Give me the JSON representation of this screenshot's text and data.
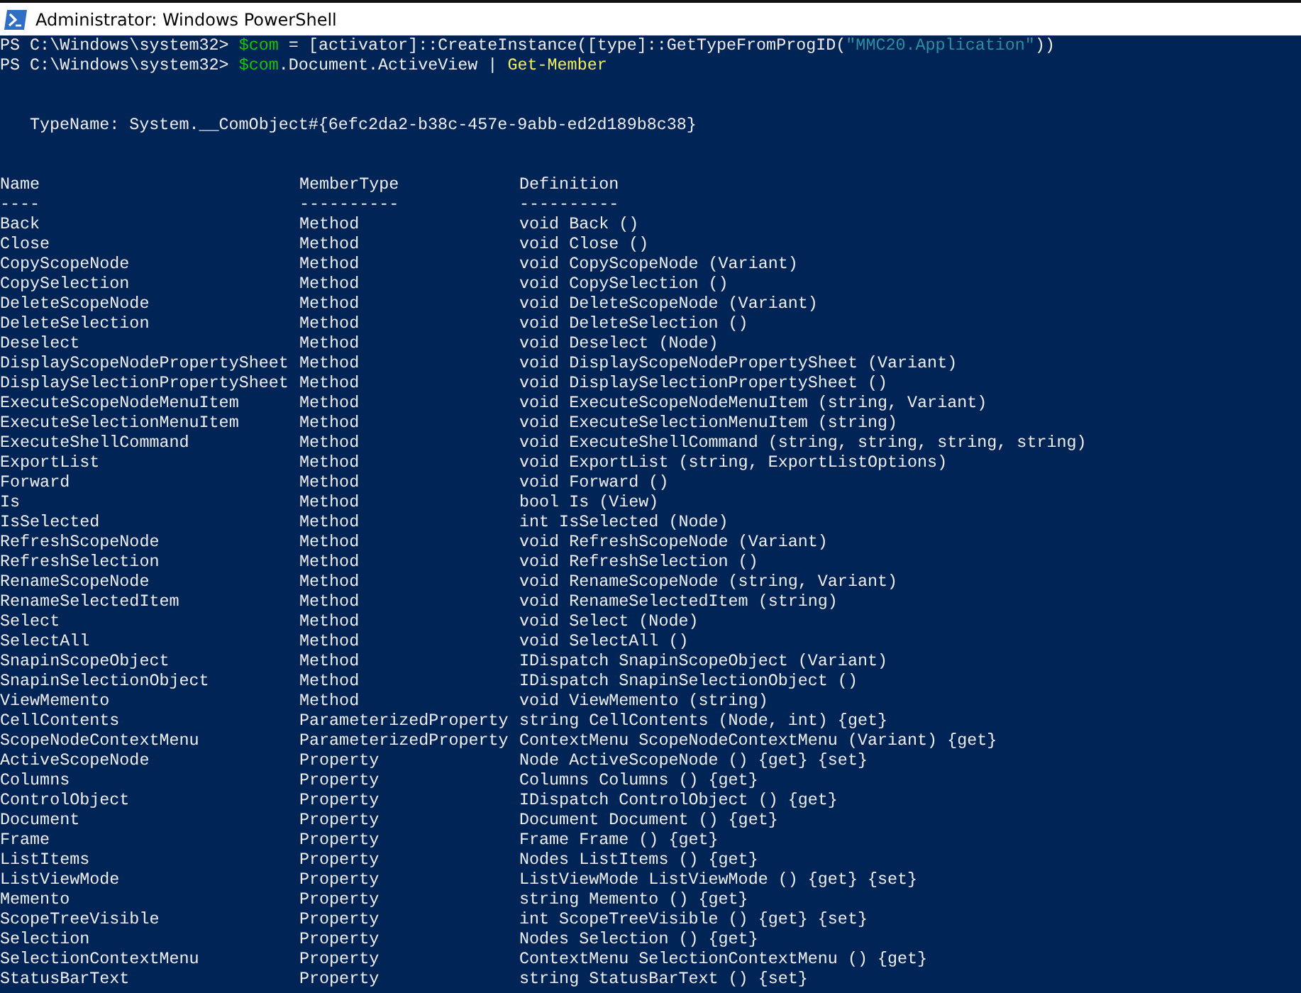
{
  "window": {
    "title": "Administrator: Windows PowerShell"
  },
  "commands": [
    {
      "prompt": "PS C:\\Windows\\system32> ",
      "segments": [
        {
          "text": "$com",
          "kind": "variable"
        },
        {
          "text": " = [activator]::CreateInstance([type]::GetTypeFromProgID(",
          "kind": "plain"
        },
        {
          "text": "\"MMC20.Application\"",
          "kind": "string"
        },
        {
          "text": "))",
          "kind": "plain"
        }
      ]
    },
    {
      "prompt": "PS C:\\Windows\\system32> ",
      "segments": [
        {
          "text": "$com",
          "kind": "variable"
        },
        {
          "text": ".Document.ActiveView | ",
          "kind": "plain"
        },
        {
          "text": "Get-Member",
          "kind": "command"
        }
      ]
    }
  ],
  "type_name": "TypeName: System.__ComObject#{6efc2da2-b38c-457e-9abb-ed2d189b8c38}",
  "table": {
    "columns": [
      "Name",
      "MemberType",
      "Definition"
    ],
    "underlines": [
      "----",
      "----------",
      "----------"
    ],
    "rows": [
      [
        "Back",
        "Method",
        "void Back ()"
      ],
      [
        "Close",
        "Method",
        "void Close ()"
      ],
      [
        "CopyScopeNode",
        "Method",
        "void CopyScopeNode (Variant)"
      ],
      [
        "CopySelection",
        "Method",
        "void CopySelection ()"
      ],
      [
        "DeleteScopeNode",
        "Method",
        "void DeleteScopeNode (Variant)"
      ],
      [
        "DeleteSelection",
        "Method",
        "void DeleteSelection ()"
      ],
      [
        "Deselect",
        "Method",
        "void Deselect (Node)"
      ],
      [
        "DisplayScopeNodePropertySheet",
        "Method",
        "void DisplayScopeNodePropertySheet (Variant)"
      ],
      [
        "DisplaySelectionPropertySheet",
        "Method",
        "void DisplaySelectionPropertySheet ()"
      ],
      [
        "ExecuteScopeNodeMenuItem",
        "Method",
        "void ExecuteScopeNodeMenuItem (string, Variant)"
      ],
      [
        "ExecuteSelectionMenuItem",
        "Method",
        "void ExecuteSelectionMenuItem (string)"
      ],
      [
        "ExecuteShellCommand",
        "Method",
        "void ExecuteShellCommand (string, string, string, string)"
      ],
      [
        "ExportList",
        "Method",
        "void ExportList (string, ExportListOptions)"
      ],
      [
        "Forward",
        "Method",
        "void Forward ()"
      ],
      [
        "Is",
        "Method",
        "bool Is (View)"
      ],
      [
        "IsSelected",
        "Method",
        "int IsSelected (Node)"
      ],
      [
        "RefreshScopeNode",
        "Method",
        "void RefreshScopeNode (Variant)"
      ],
      [
        "RefreshSelection",
        "Method",
        "void RefreshSelection ()"
      ],
      [
        "RenameScopeNode",
        "Method",
        "void RenameScopeNode (string, Variant)"
      ],
      [
        "RenameSelectedItem",
        "Method",
        "void RenameSelectedItem (string)"
      ],
      [
        "Select",
        "Method",
        "void Select (Node)"
      ],
      [
        "SelectAll",
        "Method",
        "void SelectAll ()"
      ],
      [
        "SnapinScopeObject",
        "Method",
        "IDispatch SnapinScopeObject (Variant)"
      ],
      [
        "SnapinSelectionObject",
        "Method",
        "IDispatch SnapinSelectionObject ()"
      ],
      [
        "ViewMemento",
        "Method",
        "void ViewMemento (string)"
      ],
      [
        "CellContents",
        "ParameterizedProperty",
        "string CellContents (Node, int) {get}"
      ],
      [
        "ScopeNodeContextMenu",
        "ParameterizedProperty",
        "ContextMenu ScopeNodeContextMenu (Variant) {get}"
      ],
      [
        "ActiveScopeNode",
        "Property",
        "Node ActiveScopeNode () {get} {set}"
      ],
      [
        "Columns",
        "Property",
        "Columns Columns () {get}"
      ],
      [
        "ControlObject",
        "Property",
        "IDispatch ControlObject () {get}"
      ],
      [
        "Document",
        "Property",
        "Document Document () {get}"
      ],
      [
        "Frame",
        "Property",
        "Frame Frame () {get}"
      ],
      [
        "ListItems",
        "Property",
        "Nodes ListItems () {get}"
      ],
      [
        "ListViewMode",
        "Property",
        "ListViewMode ListViewMode () {get} {set}"
      ],
      [
        "Memento",
        "Property",
        "string Memento () {get}"
      ],
      [
        "ScopeTreeVisible",
        "Property",
        "int ScopeTreeVisible () {get} {set}"
      ],
      [
        "Selection",
        "Property",
        "Nodes Selection () {get}"
      ],
      [
        "SelectionContextMenu",
        "Property",
        "ContextMenu SelectionContextMenu () {get}"
      ],
      [
        "StatusBarText",
        "Property",
        "string StatusBarText () {set}"
      ]
    ]
  }
}
